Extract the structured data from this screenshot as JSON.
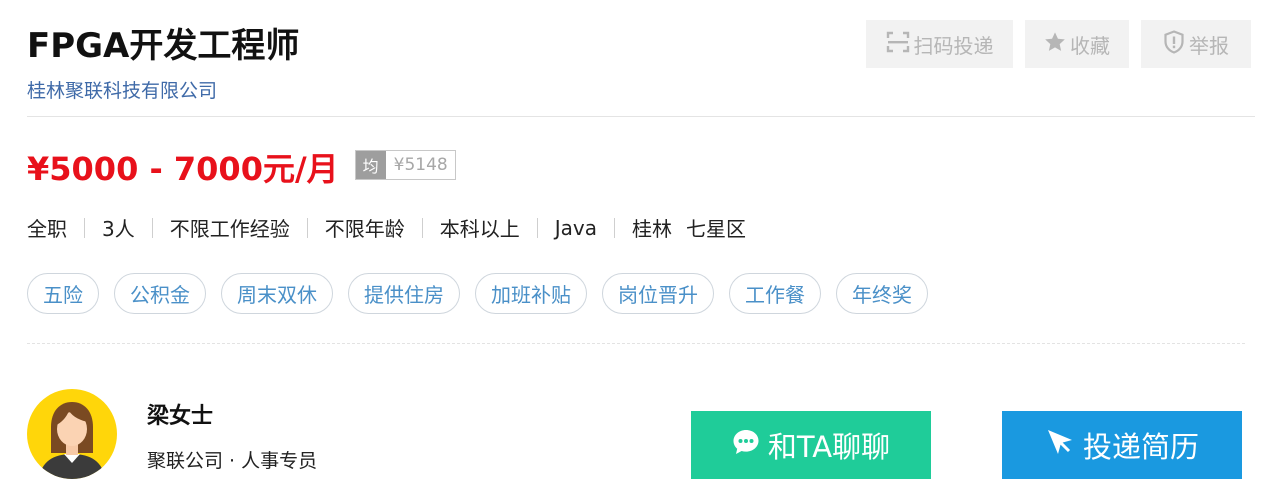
{
  "job": {
    "title": "FPGA开发工程师",
    "company": "桂林聚联科技有限公司",
    "salary": "¥5000 - 7000元/月",
    "avg_tag": "均",
    "avg_value": "¥5148"
  },
  "actions": {
    "scan_label": "扫码投递",
    "favorite_label": "收藏",
    "report_label": "举报"
  },
  "requirements": {
    "type": "全职",
    "headcount": "3人",
    "experience": "不限工作经验",
    "age": "不限年龄",
    "education": "本科以上",
    "skill": "Java",
    "city": "桂林",
    "district": "七星区"
  },
  "benefits": [
    "五险",
    "公积金",
    "周末双休",
    "提供住房",
    "加班补贴",
    "岗位晋升",
    "工作餐",
    "年终奖"
  ],
  "contact": {
    "name": "梁女士",
    "role": "聚联公司 · 人事专员"
  },
  "buttons": {
    "chat_label": "和TA聊聊",
    "apply_label": "投递简历"
  },
  "colors": {
    "salary": "#e8111b",
    "company_link": "#3f6aa8",
    "tag_text": "#4a90c8",
    "chat_button": "#1fcc99",
    "apply_button": "#1a99e0",
    "avatar_bg": "#ffd60a"
  }
}
